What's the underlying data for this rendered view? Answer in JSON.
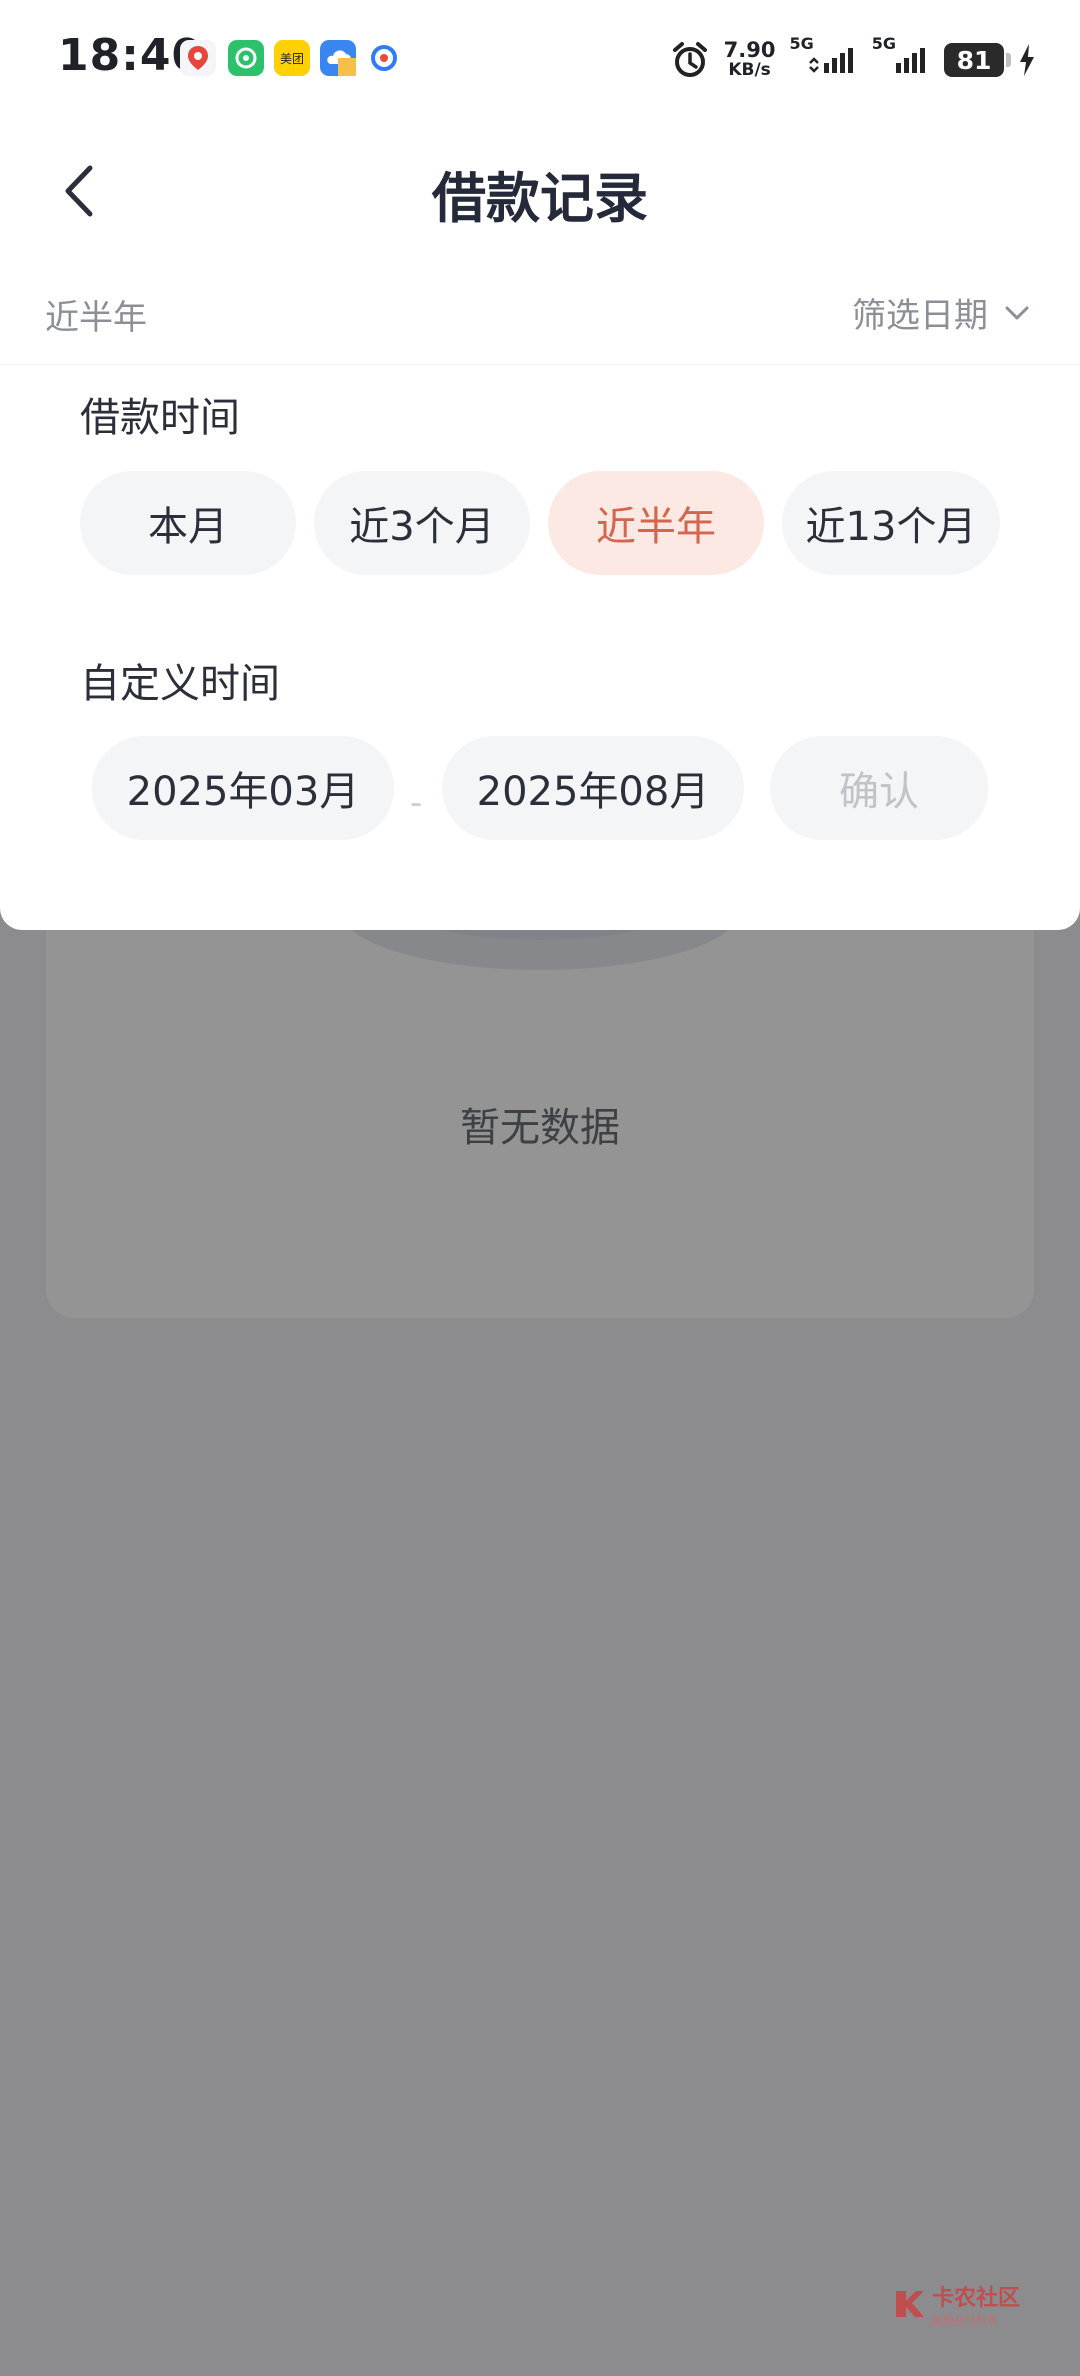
{
  "status_bar": {
    "time": "18:40",
    "net_speed_value": "7.90",
    "net_speed_unit": "KB/s",
    "sim1_label": "5G",
    "sim2_label": "5G",
    "battery": "81",
    "icons": [
      "map-app-icon",
      "phone-app-icon",
      "meituan-app-icon",
      "cloud-app-icon",
      "browser-app-icon",
      "alarm-icon",
      "signal-icon",
      "charging-icon"
    ]
  },
  "header": {
    "title": "借款记录"
  },
  "filter_bar": {
    "current_range": "近半年",
    "filter_date_label": "筛选日期"
  },
  "panel": {
    "loan_time_title": "借款时间",
    "options": [
      {
        "label": "本月",
        "selected": false
      },
      {
        "label": "近3个月",
        "selected": false
      },
      {
        "label": "近半年",
        "selected": true
      },
      {
        "label": "近13个月",
        "selected": false
      }
    ],
    "custom_title": "自定义时间",
    "start_date": "2025年03月",
    "separator": "-",
    "end_date": "2025年08月",
    "confirm_label": "确认"
  },
  "empty_state": {
    "text": "暂无数据"
  },
  "watermark": {
    "text": "卡农社区",
    "sub": "金融在线教育"
  },
  "colors": {
    "accent": "#d4654e",
    "accent_bg": "#fde9e4",
    "chip_bg": "#f4f5f7",
    "overlay": "rgba(0,0,0,0.42)"
  }
}
